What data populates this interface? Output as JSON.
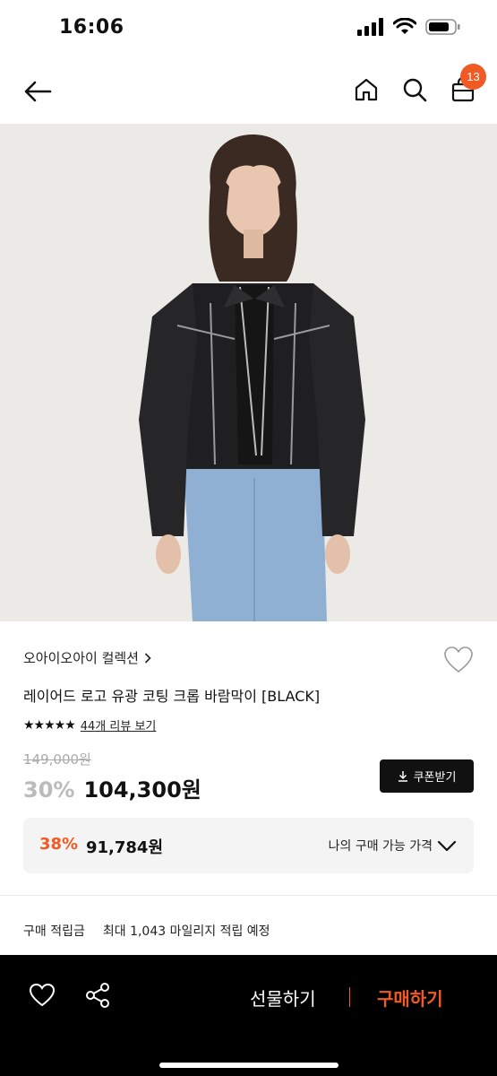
{
  "status_bar": {
    "time": "16:06"
  },
  "nav": {
    "back_icon": "arrow-left-icon",
    "home_icon": "home-icon",
    "search_icon": "search-icon",
    "cart_icon": "shopping-bag-icon",
    "cart_count": "13"
  },
  "product": {
    "brand": "오아이오아이 컬렉션",
    "name": "레이어드 로고 유광 코팅 크롭 바람막이 [BLACK]",
    "stars": "★★★★★",
    "review_link": "44개 리뷰 보기",
    "original_price": "149,000원",
    "discount_rate": "30%",
    "sale_price": "104,300원",
    "coupon_label": "쿠폰받기",
    "my_rate": "38%",
    "my_price": "91,784원",
    "my_price_label": "나의 구매 가능 가격",
    "points_label": "구매 적립금",
    "points_value": "최대 1,043 마일리지 적립 예정"
  },
  "bottom_bar": {
    "gift_label": "선물하기",
    "buy_label": "구매하기"
  },
  "colors": {
    "accent": "#f15a24",
    "image_bg": "#eceae7",
    "price_box_bg": "#f4f4f4"
  }
}
